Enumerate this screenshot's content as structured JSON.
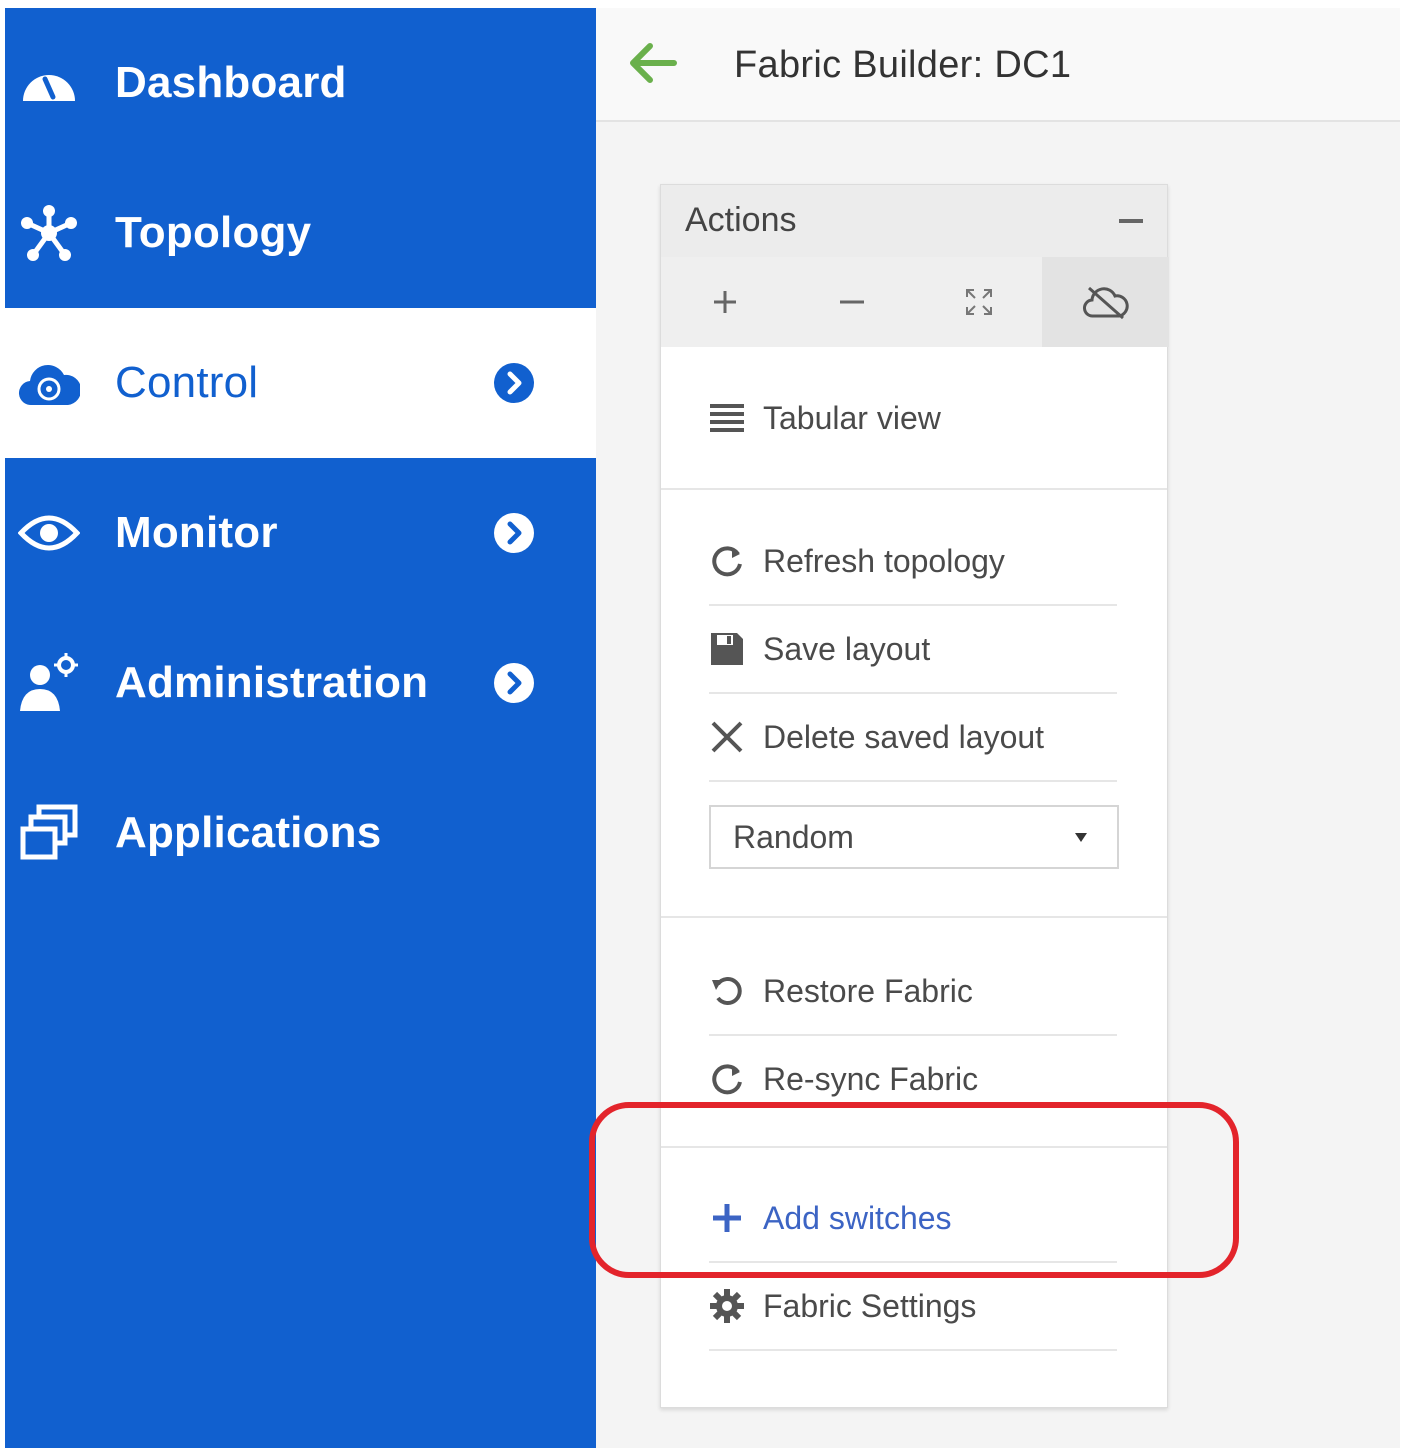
{
  "sidebar": {
    "items": [
      {
        "label": "Dashboard",
        "icon": "dashboard-gauge-icon",
        "active": false,
        "has_chevron": false
      },
      {
        "label": "Topology",
        "icon": "topology-icon",
        "active": false,
        "has_chevron": false
      },
      {
        "label": "Control",
        "icon": "control-cloud-icon",
        "active": true,
        "has_chevron": true
      },
      {
        "label": "Monitor",
        "icon": "eye-icon",
        "active": false,
        "has_chevron": true
      },
      {
        "label": "Administration",
        "icon": "admin-user-gear-icon",
        "active": false,
        "has_chevron": true
      },
      {
        "label": "Applications",
        "icon": "applications-windows-icon",
        "active": false,
        "has_chevron": false
      }
    ]
  },
  "header": {
    "title": "Fabric Builder: DC1",
    "back_icon": "back-arrow-icon"
  },
  "actions_panel": {
    "title": "Actions",
    "toolbar": [
      {
        "icon": "zoom-in-plus-icon"
      },
      {
        "icon": "zoom-out-minus-icon"
      },
      {
        "icon": "fit-screen-icon"
      },
      {
        "icon": "cloud-off-icon",
        "selected": true
      }
    ],
    "tabular_view": "Tabular view",
    "refresh_topology": "Refresh topology",
    "save_layout": "Save layout",
    "delete_saved_layout": "Delete saved layout",
    "layout_select": {
      "value": "Random"
    },
    "restore_fabric": "Restore Fabric",
    "resync_fabric": "Re-sync Fabric",
    "add_switches": "Add switches",
    "fabric_settings": "Fabric Settings"
  },
  "colors": {
    "sidebar_bg": "#1160cf",
    "link": "#3c64c4",
    "back_arrow": "#6ab04c",
    "highlight": "#e3242b"
  }
}
